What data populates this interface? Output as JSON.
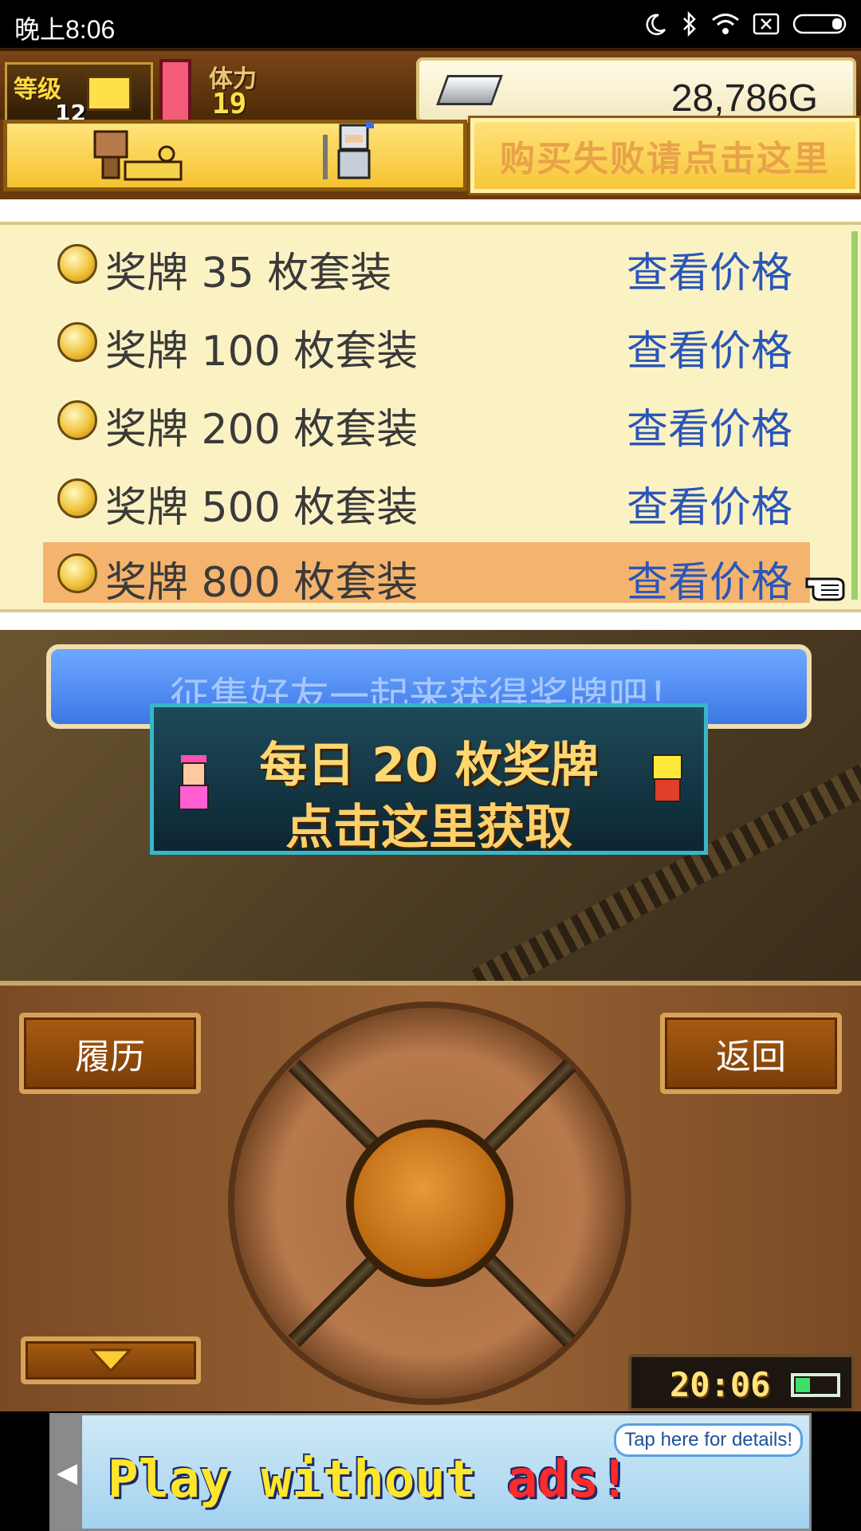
{
  "status_bar": {
    "time": "晚上8:06",
    "icons": [
      "moon-icon",
      "bluetooth-icon",
      "wifi-icon",
      "sim-off-icon",
      "battery-icon"
    ]
  },
  "header": {
    "level_label": "等级",
    "level_value": "12",
    "stamina_label": "体力",
    "stamina_value": "19",
    "money": "28,786G",
    "buy_fail_button": "购买失败请点击这里"
  },
  "shop": {
    "items": [
      {
        "label": "奖牌 35 枚套装",
        "price_label": "查看价格",
        "selected": false
      },
      {
        "label": "奖牌 100 枚套装",
        "price_label": "查看价格",
        "selected": false
      },
      {
        "label": "奖牌 200 枚套装",
        "price_label": "查看价格",
        "selected": false
      },
      {
        "label": "奖牌 500 枚套装",
        "price_label": "查看价格",
        "selected": false
      },
      {
        "label": "奖牌 800 枚套装",
        "price_label": "查看价格",
        "selected": true
      }
    ]
  },
  "scene": {
    "recruit_banner": "征集好友一起来获得奖牌吧！",
    "daily_line1": "每日 20 枚奖牌",
    "daily_line2": "点击这里获取"
  },
  "panel": {
    "history_button": "履历",
    "back_button": "返回",
    "clock": "20:06"
  },
  "ad": {
    "text_main": "Play without",
    "text_red": "ads!",
    "details": "Tap here for details!"
  },
  "colors": {
    "accent_blue": "#2a56b8",
    "selected_row": "#f4b46e",
    "list_bg": "#fbf2c4"
  }
}
